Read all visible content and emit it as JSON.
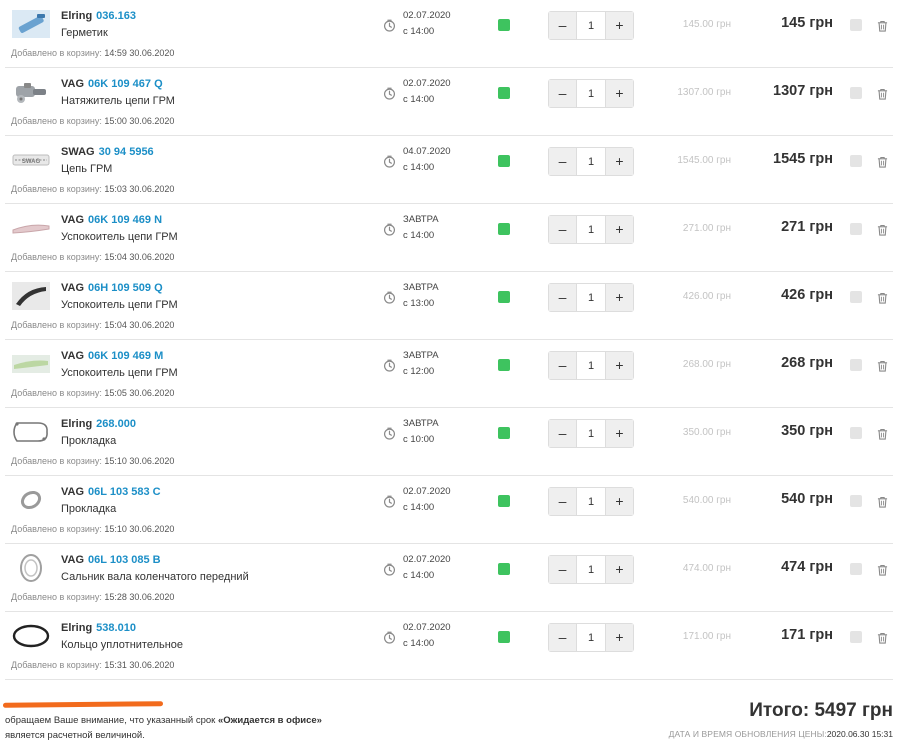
{
  "colors": {
    "accent": "#1c8fc7",
    "in_stock": "#3ec35f",
    "unit_price": "#c3c3c3",
    "divider": "#e4e4e4",
    "highlight": "#f26b1d"
  },
  "icons": {
    "clock": "clock-icon",
    "trash": "trash-icon",
    "stock": "in-stock-indicator"
  },
  "labels": {
    "added": "Добавлено в корзину:",
    "minus": "–",
    "plus": "+"
  },
  "cart": {
    "items": [
      {
        "brand": "Elring",
        "code": "036.163",
        "name": "Герметик",
        "added_time": "14:59 30.06.2020",
        "delivery_date": "02.07.2020",
        "delivery_time": "с 14:00",
        "qty": "1",
        "unit_price": "145.00 грн",
        "total": "145 грн",
        "thumb": "sealant-tube"
      },
      {
        "brand": "VAG",
        "code": "06K 109 467 Q",
        "name": "Натяжитель цепи ГРМ",
        "added_time": "15:00 30.06.2020",
        "delivery_date": "02.07.2020",
        "delivery_time": "с 14:00",
        "qty": "1",
        "unit_price": "1307.00 грн",
        "total": "1307 грн",
        "thumb": "chain-tensioner"
      },
      {
        "brand": "SWAG",
        "code": "30 94 5956",
        "name": "Цепь ГРМ",
        "added_time": "15:03 30.06.2020",
        "delivery_date": "04.07.2020",
        "delivery_time": "с 14:00",
        "qty": "1",
        "unit_price": "1545.00 грн",
        "total": "1545 грн",
        "thumb": "timing-chain"
      },
      {
        "brand": "VAG",
        "code": "06K 109 469 N",
        "name": "Успокоитель цепи ГРМ",
        "added_time": "15:04 30.06.2020",
        "delivery_date": "ЗАВТРА",
        "delivery_time": "с 14:00",
        "qty": "1",
        "unit_price": "271.00 грн",
        "total": "271 грн",
        "thumb": "chain-guide-flat"
      },
      {
        "brand": "VAG",
        "code": "06H 109 509 Q",
        "name": "Успокоитель цепи ГРМ",
        "added_time": "15:04 30.06.2020",
        "delivery_date": "ЗАВТРА",
        "delivery_time": "с 13:00",
        "qty": "1",
        "unit_price": "426.00 грн",
        "total": "426 грн",
        "thumb": "chain-guide-curved"
      },
      {
        "brand": "VAG",
        "code": "06K 109 469 M",
        "name": "Успокоитель цепи ГРМ",
        "added_time": "15:05 30.06.2020",
        "delivery_date": "ЗАВТРА",
        "delivery_time": "с 12:00",
        "qty": "1",
        "unit_price": "268.00 грн",
        "total": "268 грн",
        "thumb": "chain-guide-green"
      },
      {
        "brand": "Elring",
        "code": "268.000",
        "name": "Прокладка",
        "added_time": "15:10 30.06.2020",
        "delivery_date": "ЗАВТРА",
        "delivery_time": "с 10:00",
        "qty": "1",
        "unit_price": "350.00 грн",
        "total": "350 грн",
        "thumb": "gasket-outline"
      },
      {
        "brand": "VAG",
        "code": "06L 103 583 C",
        "name": "Прокладка",
        "added_time": "15:10 30.06.2020",
        "delivery_date": "02.07.2020",
        "delivery_time": "с 14:00",
        "qty": "1",
        "unit_price": "540.00 грн",
        "total": "540 грн",
        "thumb": "gasket-oval"
      },
      {
        "brand": "VAG",
        "code": "06L 103 085 B",
        "name": "Сальник вала коленчатого передний",
        "added_time": "15:28 30.06.2020",
        "delivery_date": "02.07.2020",
        "delivery_time": "с 14:00",
        "qty": "1",
        "unit_price": "474.00 грн",
        "total": "474 грн",
        "thumb": "shaft-seal"
      },
      {
        "brand": "Elring",
        "code": "538.010",
        "name": "Кольцо уплотнительное",
        "added_time": "15:31 30.06.2020",
        "delivery_date": "02.07.2020",
        "delivery_time": "с 14:00",
        "qty": "1",
        "unit_price": "171.00 грн",
        "total": "171 грн",
        "thumb": "o-ring"
      }
    ]
  },
  "footer": {
    "note_pre": "обращаем Ваше внимание, что указанный срок ",
    "note_bold": "«Ожидается в офисе»",
    "note_post": " является расчетной величиной.",
    "total": "Итого: 5497 грн",
    "updated_label": "ДАТА И ВРЕМЯ ОБНОВЛЕНИЯ ЦЕНЫ:",
    "updated_value": "2020.06.30 15:31"
  }
}
